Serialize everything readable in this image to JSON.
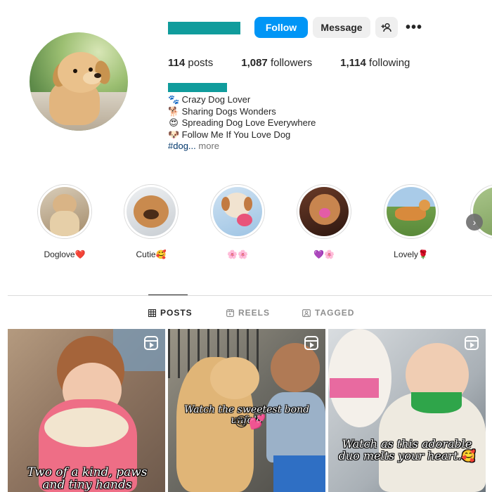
{
  "header": {
    "follow_label": "Follow",
    "message_label": "Message",
    "suggest_icon": "person-plus-icon",
    "more_icon": "more-options-icon",
    "more_glyph": "•••"
  },
  "stats": {
    "posts_count": "114",
    "posts_label": "posts",
    "followers_count": "1,087",
    "followers_label": "followers",
    "following_count": "1,114",
    "following_label": "following"
  },
  "bio": {
    "lines": [
      {
        "emoji": "🐾",
        "text": "Crazy Dog Lover"
      },
      {
        "emoji": "🐕",
        "text": "Sharing Dogs Wonders"
      },
      {
        "emoji": "😍",
        "text": "Spreading Dog Love Everywhere"
      },
      {
        "emoji": "🐶",
        "text": "Follow Me If You Love Dog"
      }
    ],
    "hashtag": "#dog",
    "ellipsis": "...",
    "more_label": "more"
  },
  "highlights": [
    {
      "label": "Doglove❤️"
    },
    {
      "label": "Cutie🥰"
    },
    {
      "label": "🌸🌸"
    },
    {
      "label": "💜🌸"
    },
    {
      "label": "Lovely🌹"
    },
    {
      "label": "("
    }
  ],
  "tabs": [
    {
      "label": "POSTS",
      "icon": "grid-icon",
      "active": true
    },
    {
      "label": "REELS",
      "icon": "reels-icon",
      "active": false
    },
    {
      "label": "TAGGED",
      "icon": "tagged-icon",
      "active": false
    }
  ],
  "posts": [
    {
      "caption": "Two of a kind, paws and tiny hands"
    },
    {
      "caption": "Watch the sweetest bond unfold",
      "emojis": "😍💕"
    },
    {
      "caption": "Watch as this adorable duo melts your heart.",
      "emoji": "🥰"
    }
  ],
  "colors": {
    "accent": "#0095f6",
    "redacted": "#109c9c"
  }
}
